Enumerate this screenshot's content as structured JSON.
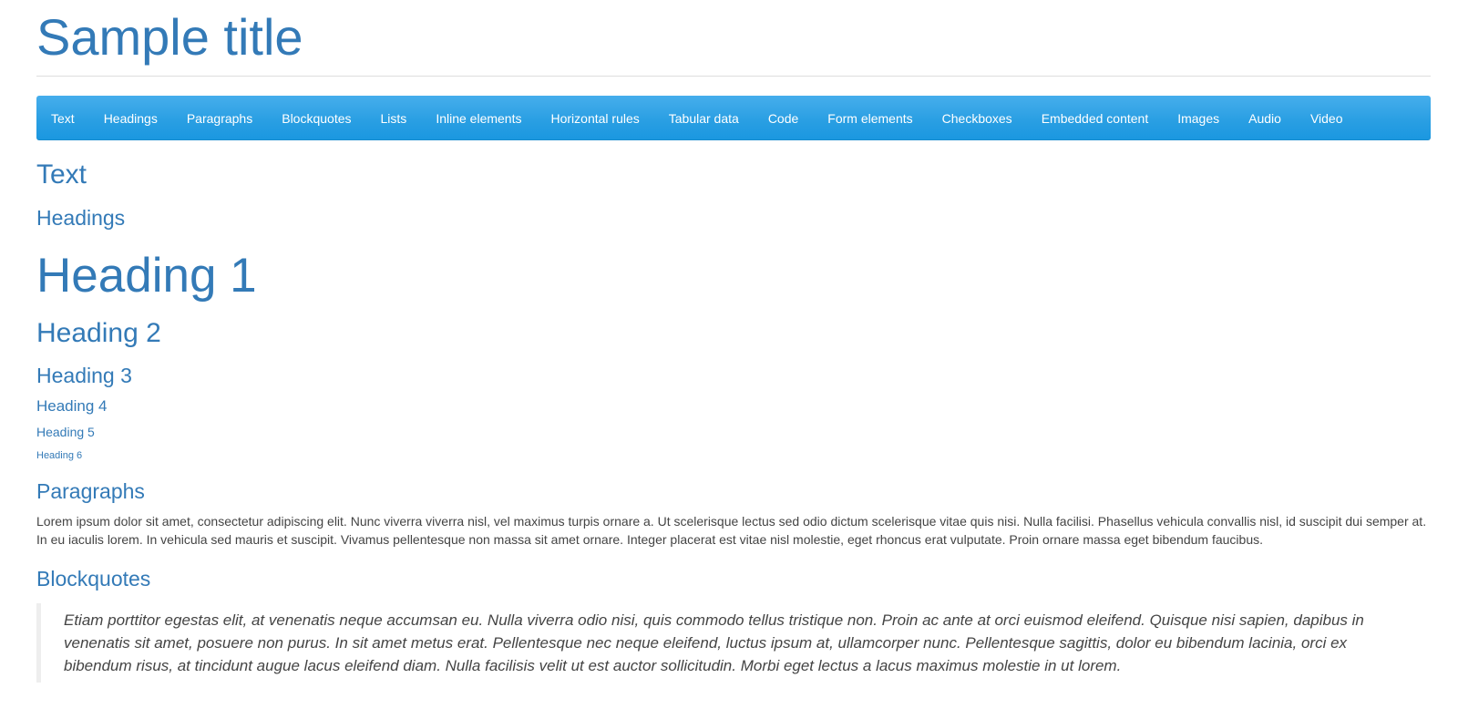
{
  "header": {
    "title": "Sample title"
  },
  "nav": {
    "items": [
      "Text",
      "Headings",
      "Paragraphs",
      "Blockquotes",
      "Lists",
      "Inline elements",
      "Horizontal rules",
      "Tabular data",
      "Code",
      "Form elements",
      "Checkboxes",
      "Embedded content",
      "Images",
      "Audio",
      "Video"
    ]
  },
  "sections": {
    "text": "Text",
    "headings": "Headings",
    "paragraphs": "Paragraphs",
    "blockquotes": "Blockquotes"
  },
  "headings_demo": {
    "h1": "Heading 1",
    "h2": "Heading 2",
    "h3": "Heading 3",
    "h4": "Heading 4",
    "h5": "Heading 5",
    "h6": "Heading 6"
  },
  "paragraph": "Lorem ipsum dolor sit amet, consectetur adipiscing elit. Nunc viverra viverra nisl, vel maximus turpis ornare a. Ut scelerisque lectus sed odio dictum scelerisque vitae quis nisi. Nulla facilisi. Phasellus vehicula convallis nisl, id suscipit dui semper at. In eu iaculis lorem. In vehicula sed mauris et suscipit. Vivamus pellentesque non massa sit amet ornare. Integer placerat est vitae nisl molestie, eget rhoncus erat vulputate. Proin ornare massa eget bibendum faucibus.",
  "blockquote": "Etiam porttitor egestas elit, at venenatis neque accumsan eu. Nulla viverra odio nisi, quis commodo tellus tristique non. Proin ac ante at orci euismod eleifend. Quisque nisi sapien, dapibus in venenatis sit amet, posuere non purus. In sit amet metus erat. Pellentesque nec neque eleifend, luctus ipsum at, ullamcorper nunc. Pellentesque sagittis, dolor eu bibendum lacinia, orci ex bibendum risus, at tincidunt augue lacus eleifend diam. Nulla facilisis velit ut est auctor sollicitudin. Morbi eget lectus a lacus maximus molestie in ut lorem.",
  "colors": {
    "heading": "#337ab7",
    "navbar": "#2a9fe3",
    "body_text": "#444444",
    "rule": "#dddddd",
    "blockquote_border": "#eeeeee"
  }
}
